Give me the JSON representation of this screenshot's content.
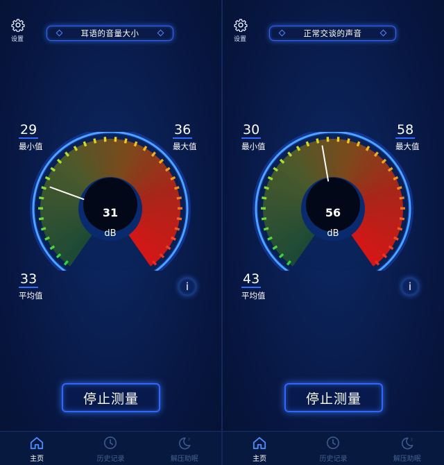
{
  "screens": [
    {
      "settings_label": "设置",
      "mode_title": "耳语的音量大小",
      "gauge": {
        "value": "31",
        "unit": "dB",
        "needle_db": 31
      },
      "stats": {
        "min": {
          "value": "29",
          "label": "最小值"
        },
        "max": {
          "value": "36",
          "label": "最大值"
        },
        "avg": {
          "value": "33",
          "label": "平均值"
        }
      },
      "info_label": "i",
      "stop_button": "停止测量",
      "tabs": [
        {
          "label": "主页",
          "icon": "home-icon",
          "active": true
        },
        {
          "label": "历史记录",
          "icon": "clock-icon",
          "active": false
        },
        {
          "label": "解压助眠",
          "icon": "moon-icon",
          "active": false
        }
      ]
    },
    {
      "settings_label": "设置",
      "mode_title": "正常交谈的声音",
      "gauge": {
        "value": "56",
        "unit": "dB",
        "needle_db": 56
      },
      "stats": {
        "min": {
          "value": "30",
          "label": "最小值"
        },
        "max": {
          "value": "58",
          "label": "最大值"
        },
        "avg": {
          "value": "43",
          "label": "平均值"
        }
      },
      "info_label": "i",
      "stop_button": "停止测量",
      "tabs": [
        {
          "label": "主页",
          "icon": "home-icon",
          "active": true
        },
        {
          "label": "历史记录",
          "icon": "clock-icon",
          "active": false
        },
        {
          "label": "解压助眠",
          "icon": "moon-icon",
          "active": false
        }
      ]
    }
  ],
  "colors": {
    "accent": "#2f66ff",
    "gauge_green": "#22c83a",
    "gauge_yellow": "#e8d21e",
    "gauge_red": "#e82323",
    "inactive_tab": "#44608e"
  }
}
